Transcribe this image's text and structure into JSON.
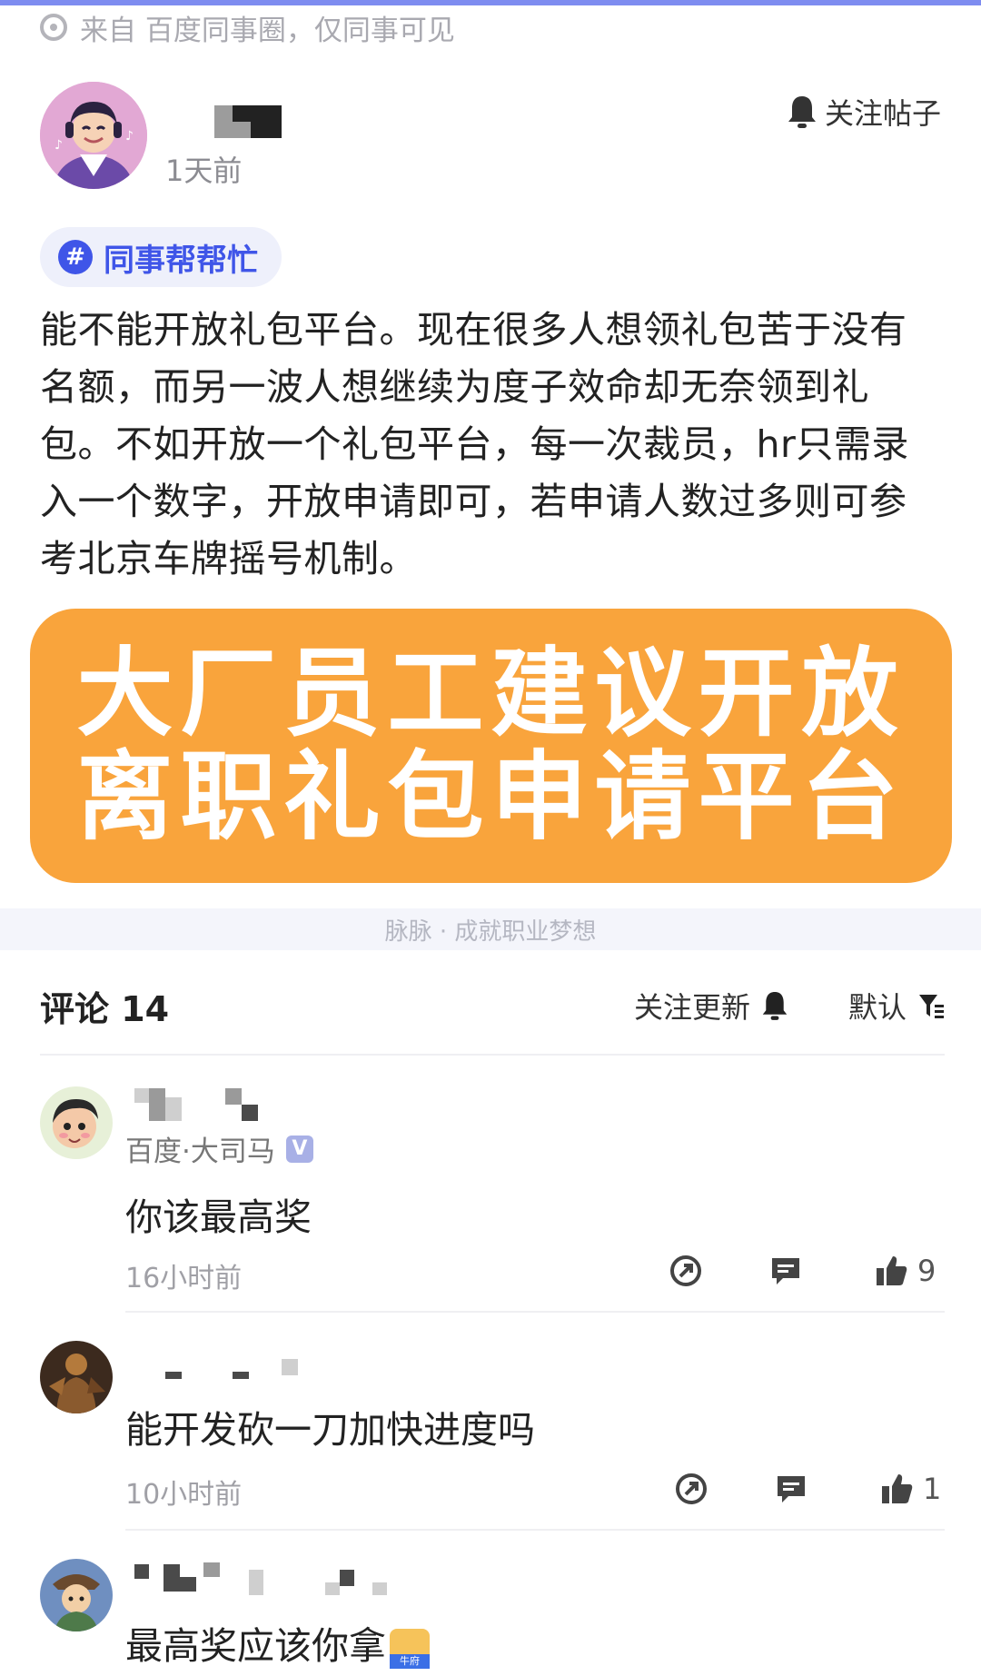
{
  "source": {
    "text": "来自 百度同事圈，仅同事可见",
    "icon": "location-dot-icon"
  },
  "post": {
    "time": "1天前",
    "follow_label": "关注帖子",
    "topic_tag": "同事帮帮忙",
    "topic_hash": "#",
    "body": "能不能开放礼包平台。现在很多人想领礼包苦于没有名额，而另一波人想继续为度子效命却无奈领到礼包。不如开放一个礼包平台，每一次裁员，hr只需录入一个数字，开放申请即可，若申请人数过多则可参考北京车牌摇号机制。",
    "banner_line1": "大厂员工建议开放",
    "banner_line2": "离职礼包申请平台",
    "banner_color": "#f9a43c"
  },
  "watermark": "脉脉 · 成就职业梦想",
  "comments_section": {
    "title": "评论 14",
    "follow_updates_label": "关注更新",
    "sort_label": "默认"
  },
  "comments": [
    {
      "company": "百度·大司马",
      "verified_badge": "V",
      "text": "你该最高奖",
      "time": "16小时前",
      "likes": "9"
    },
    {
      "text": "能开发砍一刀加快进度吗",
      "time": "10小时前",
      "likes": "1"
    },
    {
      "text": "最高奖应该你拿",
      "emoji_label": "牛府"
    }
  ],
  "colors": {
    "accent": "#3f55e8",
    "banner": "#f9a43c",
    "top_bar": "#7e8cf0"
  }
}
